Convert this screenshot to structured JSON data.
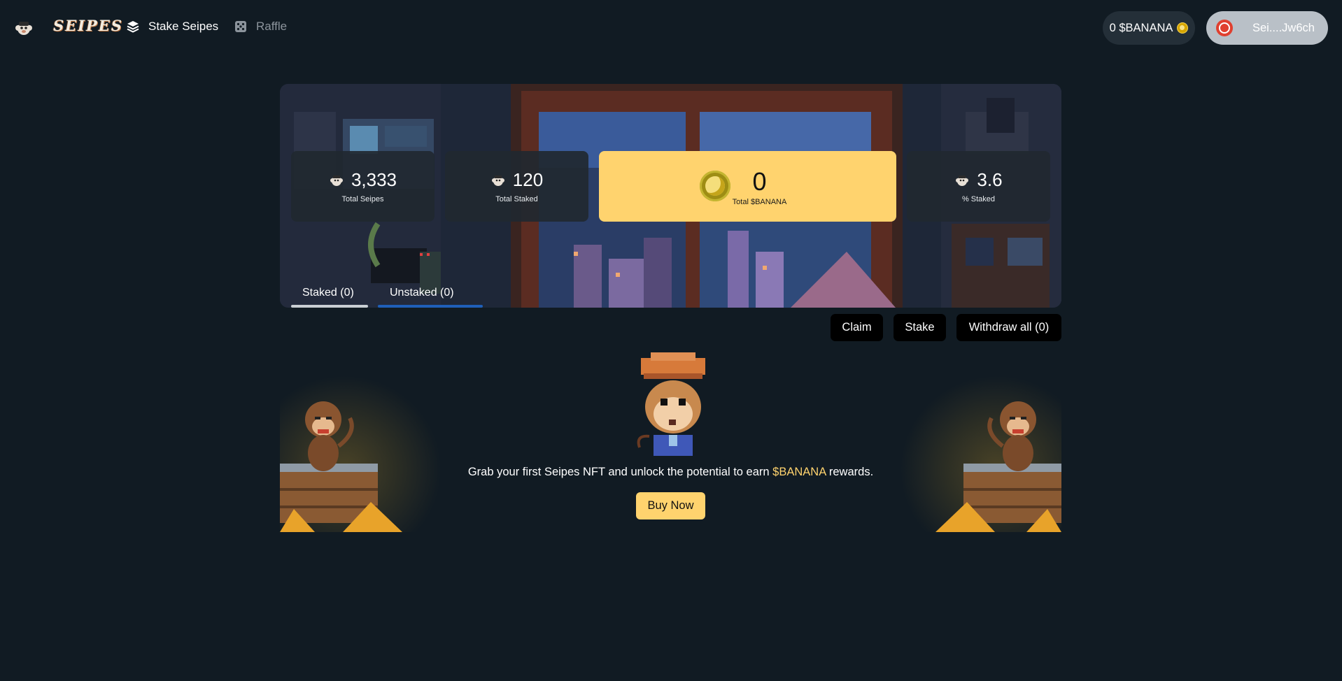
{
  "nav": {
    "brand": "SEIPES",
    "links": [
      {
        "label": "Stake Seipes",
        "icon": "layers-icon",
        "active": true
      },
      {
        "label": "Raffle",
        "icon": "dice-icon",
        "active": false
      }
    ],
    "balance": "0 $BANANA",
    "wallet": "Sei....Jw6ch"
  },
  "stats": [
    {
      "value": "3,333",
      "label": "Total Seipes"
    },
    {
      "value": "120",
      "label": "Total Staked"
    },
    {
      "value": "0",
      "label": "Total $BANANA"
    },
    {
      "value": "3.6",
      "label": "% Staked"
    }
  ],
  "tabs": [
    {
      "label": "Staked (0)",
      "active": true
    },
    {
      "label": "Unstaked (0)",
      "active": false
    }
  ],
  "actions": {
    "claim": "Claim",
    "stake": "Stake",
    "withdraw": "Withdraw all (0)"
  },
  "empty_state": {
    "text_before": "Grab your first Seipes NFT and unlock the potential to earn ",
    "highlight": "$BANANA",
    "text_after": " rewards.",
    "button": "Buy Now"
  },
  "colors": {
    "background": "#111b23",
    "accent": "#ffd36e",
    "pill": "#242f38"
  }
}
